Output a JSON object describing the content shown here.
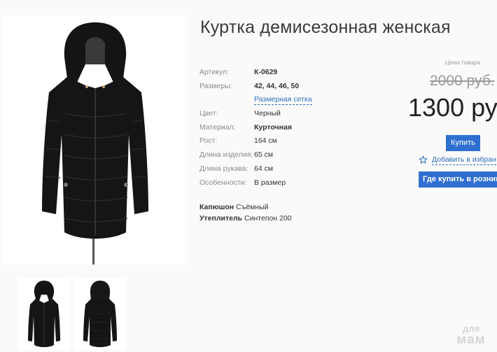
{
  "product": {
    "title": "Куртка демисезонная женская",
    "specs": [
      {
        "label": "Артикул:",
        "value": "К-0629",
        "bold": true
      },
      {
        "label": "Размеры:",
        "value": "42, 44, 46, 50",
        "bold": true
      },
      {
        "label": "Цвет:",
        "value": "Черный",
        "bold": false
      },
      {
        "label": "Материал:",
        "value": "Курточная",
        "bold": true
      },
      {
        "label": "Рост:",
        "value": "164 см",
        "bold": false
      },
      {
        "label": "Длина изделия:",
        "value": "65 см",
        "bold": false
      },
      {
        "label": "Длина рукава:",
        "value": "64 см",
        "bold": false
      },
      {
        "label": "Особенности:",
        "value": "В размер",
        "bold": false
      }
    ],
    "size_chart_link": "Размерная сетка",
    "extras": [
      {
        "label": "Капюшон",
        "value": "Съёмный"
      },
      {
        "label": "Утеплитель",
        "value": "Синтепон 200"
      }
    ]
  },
  "price": {
    "label": "Цена товара",
    "old": "2000 руб.",
    "new": "1300 ру"
  },
  "actions": {
    "buy": "Купить",
    "favorite": "Добавить в избран",
    "where_to_buy": "Где купить в розниц"
  },
  "watermark": {
    "line1": "для",
    "line2": "мам"
  },
  "colors": {
    "accent": "#2f6fd0",
    "link": "#2b6fb7",
    "jacket": "#151515"
  }
}
